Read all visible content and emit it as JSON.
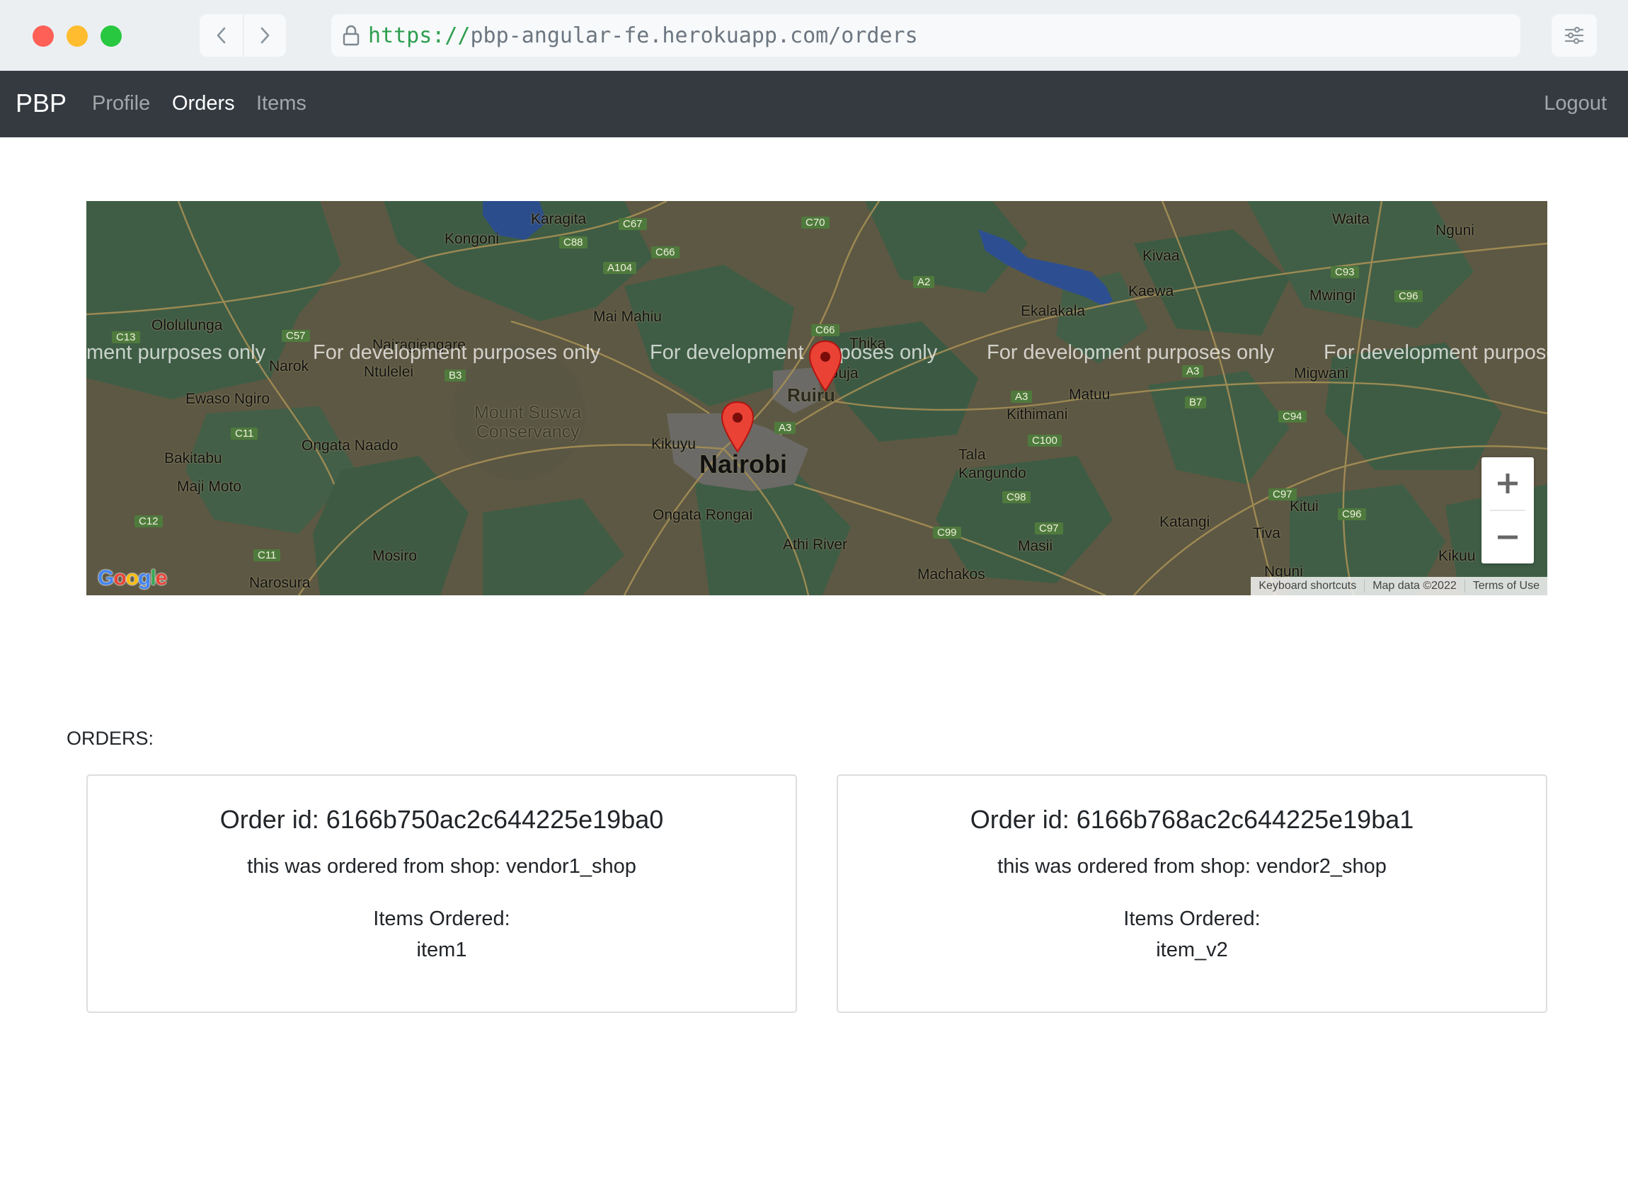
{
  "browser": {
    "url_scheme": "https://",
    "url_rest": "pbp-angular-fe.herokuapp.com/orders"
  },
  "navbar": {
    "brand": "PBP",
    "links": [
      {
        "label": "Profile",
        "active": false
      },
      {
        "label": "Orders",
        "active": true
      },
      {
        "label": "Items",
        "active": false
      }
    ],
    "logout": "Logout"
  },
  "map": {
    "watermark": "For development purposes only",
    "watermark_partial_left": "ment purposes only",
    "watermark_partial_right": "For development purpose",
    "labels": {
      "nairobi": "Nairobi",
      "ruiru": "Ruiru",
      "kikuyu": "Kikuyu",
      "ongata_rongai": "Ongata Rongai",
      "athi_river": "Athi River",
      "machakos": "Machakos",
      "masii": "Masii",
      "katangi": "Katangi",
      "tala_kangundo": "Tala\nKangundo",
      "kithimani": "Kithimani",
      "matuu": "Matuu",
      "ekalakala": "Ekalakala",
      "kaewa": "Kaewa",
      "kivaa": "Kivaa",
      "waita": "Waita",
      "nguni": "Nguni",
      "mwingi": "Mwingi",
      "migwani": "Migwani",
      "kitui": "Kitui",
      "tiva": "Tiva",
      "kikuu": "Kikuu",
      "nguni2": "Nguni",
      "thika": "Thika",
      "juja": "Juja",
      "mai_mahiu": "Mai Mahiu",
      "karagita": "Karagita",
      "kongoni": "Kongoni",
      "ololulunga": "Ololulunga",
      "narok": "Narok",
      "nairagiengare": "Nairagiengare",
      "ntulelei": "Ntulelei",
      "ewaso_ngiro": "Ewaso Ngiro",
      "ongata_naado": "Ongata Naado",
      "bakitabu": "Bakitabu",
      "maji_moto": "Maji Moto",
      "mosiro": "Mosiro",
      "narosura": "Narosura",
      "mount_suswa": "Mount Suswa\nConservancy"
    },
    "shields": [
      "C67",
      "C88",
      "C66",
      "A104",
      "C70",
      "A2",
      "C57",
      "C13",
      "B3",
      "C66",
      "A3",
      "A3",
      "B7",
      "C93",
      "C96",
      "A3",
      "C94",
      "C11",
      "C100",
      "C98",
      "C97",
      "C97",
      "C99",
      "C96",
      "C12",
      "C11"
    ],
    "attribution": {
      "keyboard": "Keyboard shortcuts",
      "data": "Map data ©2022",
      "terms": "Terms of Use"
    },
    "logo": "Google",
    "zoom_in": "+",
    "zoom_out": "−"
  },
  "orders": {
    "heading": "ORDERS:",
    "list": [
      {
        "title": "Order id: 6166b750ac2c644225e19ba0",
        "shop": "this was ordered from shop: vendor1_shop",
        "items_label": "Items Ordered:",
        "items": [
          "item1"
        ]
      },
      {
        "title": "Order id: 6166b768ac2c644225e19ba1",
        "shop": "this was ordered from shop: vendor2_shop",
        "items_label": "Items Ordered:",
        "items": [
          "item_v2"
        ]
      }
    ]
  },
  "colors": {
    "navbar_bg": "#343a40",
    "marker": "#ea4335",
    "url_scheme": "#2e9e4f"
  }
}
